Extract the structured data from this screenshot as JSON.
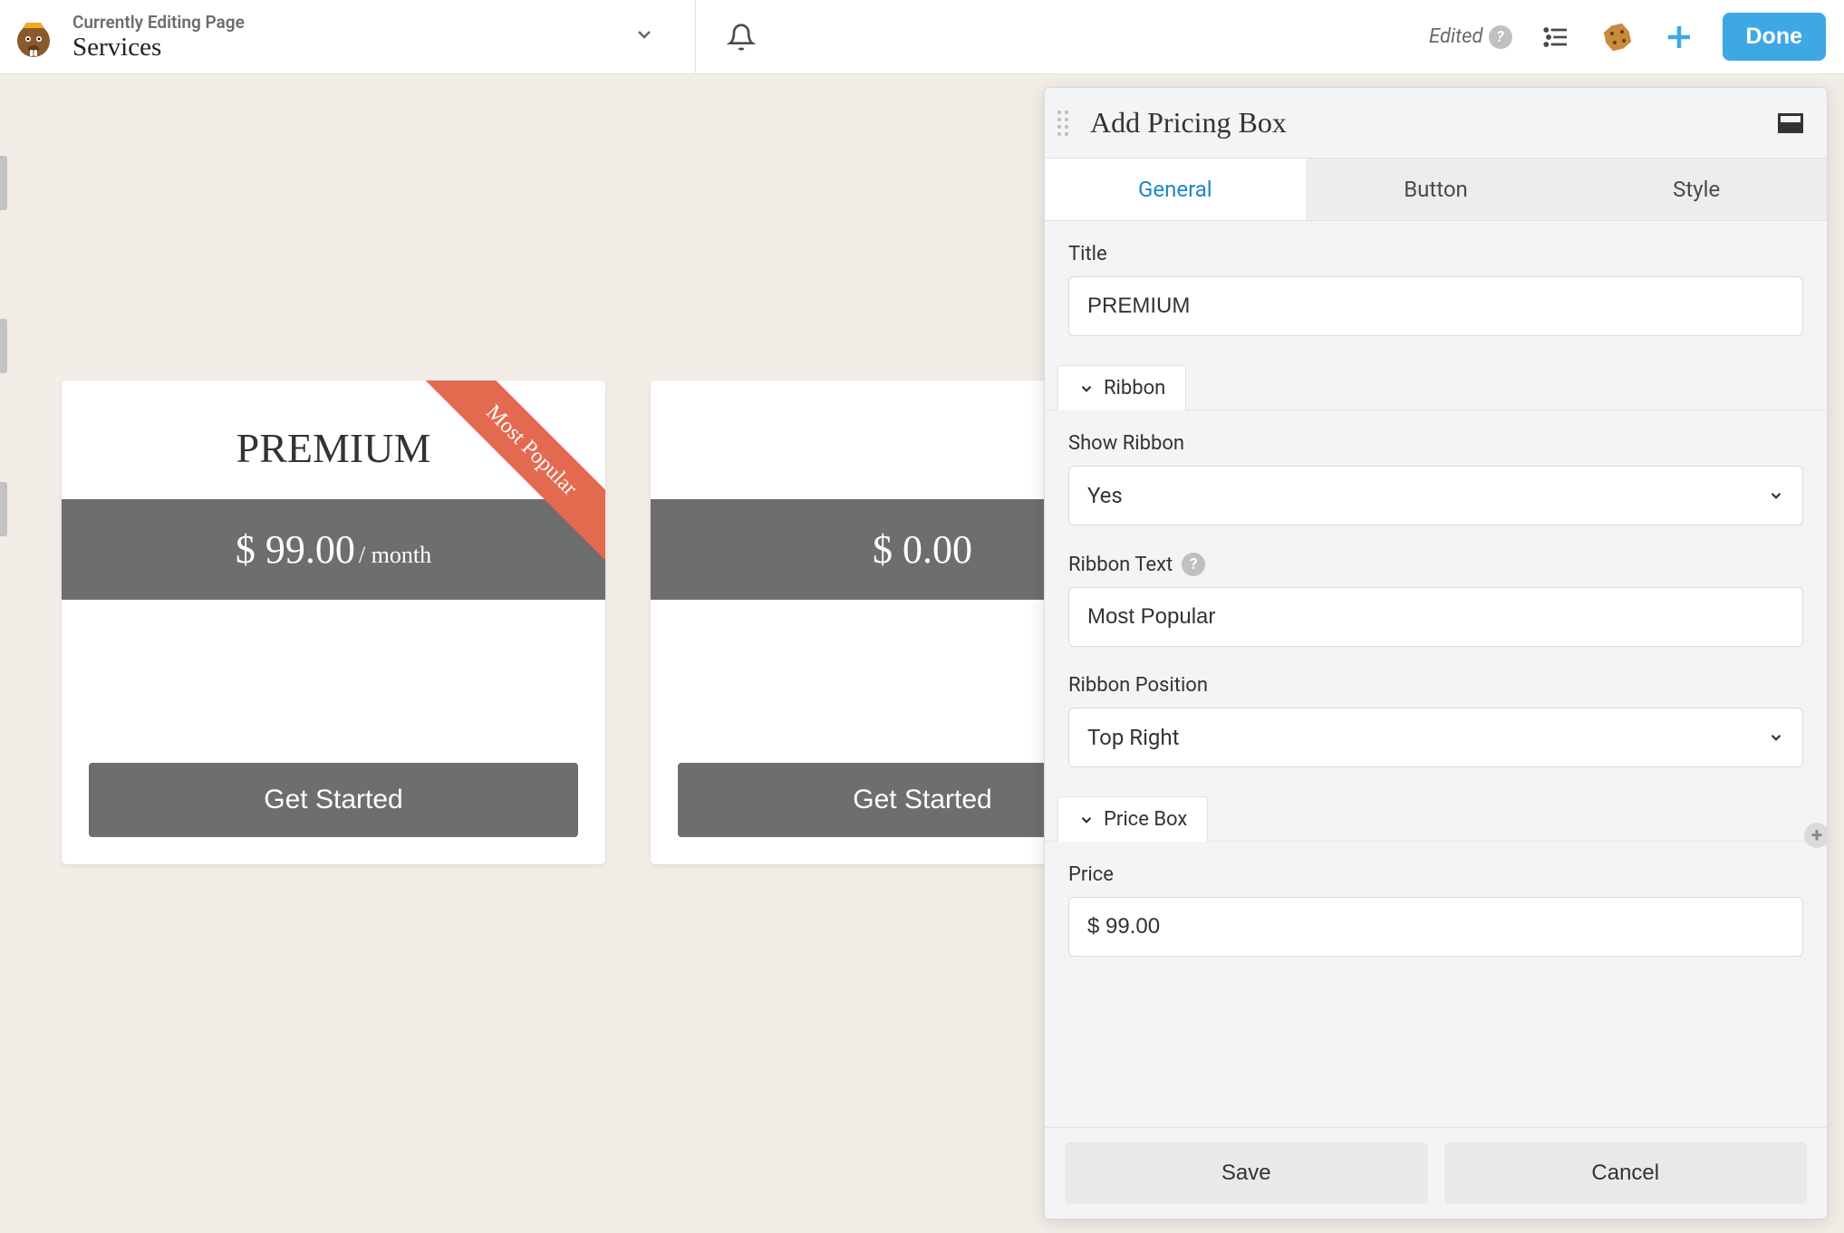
{
  "topbar": {
    "editing_label": "Currently Editing Page",
    "page_title": "Services",
    "edited_label": "Edited",
    "done_label": "Done"
  },
  "cards": [
    {
      "title": "PREMIUM",
      "price": "$ 99.00",
      "unit": "/ month",
      "button": "Get Started",
      "ribbon": "Most Popular"
    },
    {
      "title": "",
      "price": "$ 0.00",
      "unit": "",
      "button": "Get Started"
    }
  ],
  "panel": {
    "title": "Add Pricing Box",
    "tabs": [
      "General",
      "Button",
      "Style"
    ],
    "active_tab": "General",
    "sections": {
      "title_label": "Title",
      "title_value": "PREMIUM",
      "ribbon_section": "Ribbon",
      "show_ribbon_label": "Show Ribbon",
      "show_ribbon_value": "Yes",
      "ribbon_text_label": "Ribbon Text",
      "ribbon_text_value": "Most Popular",
      "ribbon_position_label": "Ribbon Position",
      "ribbon_position_value": "Top Right",
      "pricebox_section": "Price Box",
      "price_label": "Price",
      "price_value": "$ 99.00"
    },
    "footer": {
      "save": "Save",
      "cancel": "Cancel"
    }
  }
}
